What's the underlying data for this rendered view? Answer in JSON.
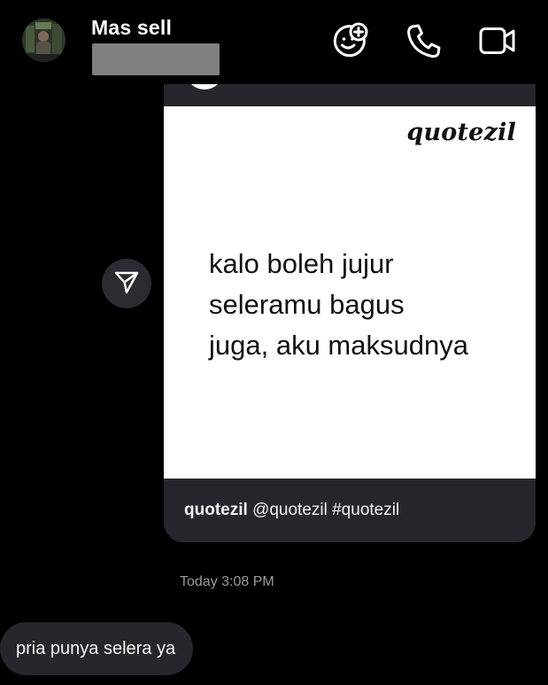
{
  "header": {
    "contact_name": "Mas sell",
    "icons": {
      "effects": "face-effects-icon",
      "call": "phone-icon",
      "video": "video-camera-icon"
    }
  },
  "post": {
    "brand": "quotezil",
    "quote_lines": [
      "kalo boleh jujur",
      "seleramu bagus",
      "juga, aku maksudnya"
    ],
    "caption_username": "quotezil",
    "caption_text": "@quotezil #quotezil"
  },
  "share": {
    "icon": "share-send-icon"
  },
  "timestamp": "Today 3:08 PM",
  "messages": [
    {
      "text": "pria punya selera ya"
    }
  ],
  "colors": {
    "background": "#000000",
    "bubble": "#26272c",
    "timestamp": "#9a9a9a",
    "post_image_bg": "#ffffff"
  }
}
